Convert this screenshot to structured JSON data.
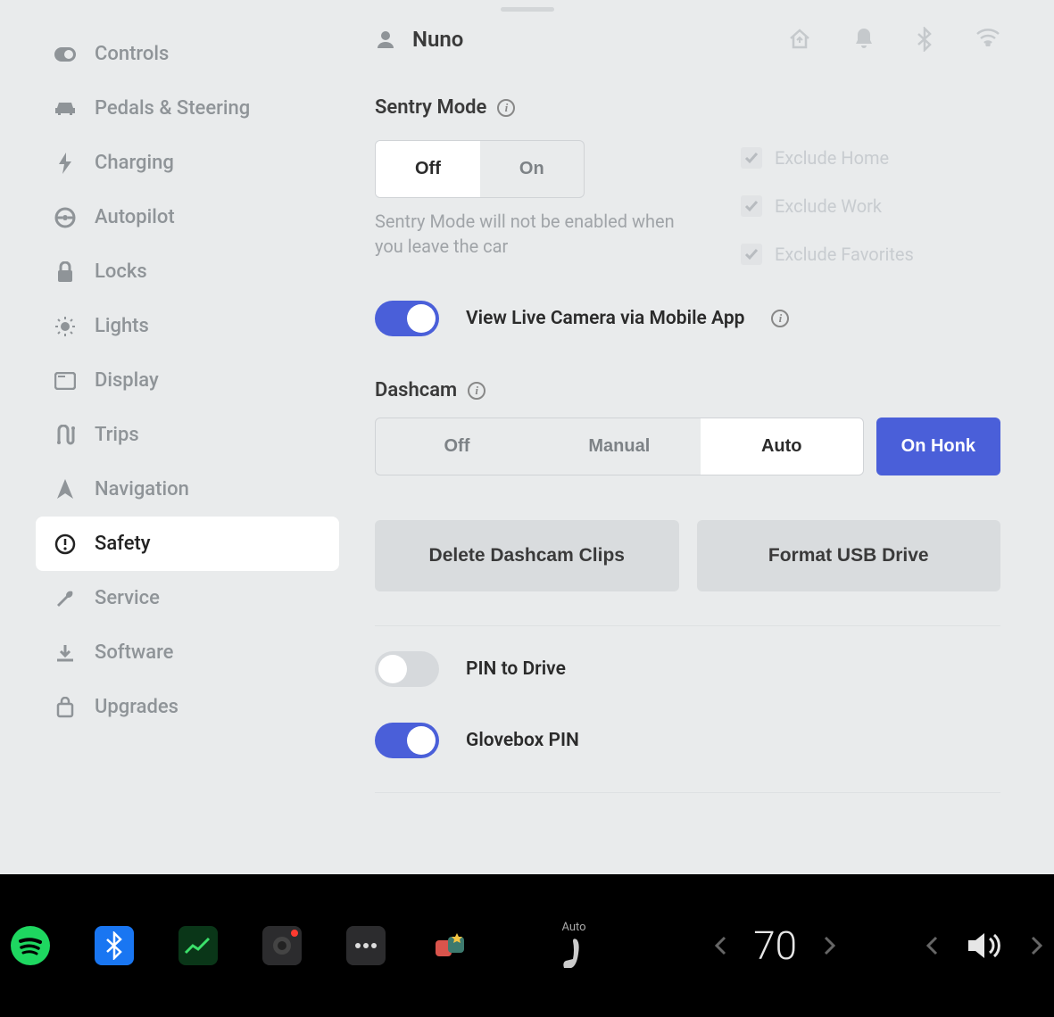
{
  "sidebar": {
    "items": [
      {
        "label": "Controls"
      },
      {
        "label": "Pedals & Steering"
      },
      {
        "label": "Charging"
      },
      {
        "label": "Autopilot"
      },
      {
        "label": "Locks"
      },
      {
        "label": "Lights"
      },
      {
        "label": "Display"
      },
      {
        "label": "Trips"
      },
      {
        "label": "Navigation"
      },
      {
        "label": "Safety"
      },
      {
        "label": "Service"
      },
      {
        "label": "Software"
      },
      {
        "label": "Upgrades"
      }
    ]
  },
  "header": {
    "profile_name": "Nuno"
  },
  "sentry": {
    "title": "Sentry Mode",
    "off": "Off",
    "on": "On",
    "help_text": "Sentry Mode will not be enabled when you leave the car",
    "exclude_home": "Exclude Home",
    "exclude_work": "Exclude Work",
    "exclude_favorites": "Exclude Favorites"
  },
  "live_camera": {
    "label": "View Live Camera via Mobile App"
  },
  "dashcam": {
    "title": "Dashcam",
    "off": "Off",
    "manual": "Manual",
    "auto": "Auto",
    "on_honk": "On Honk"
  },
  "actions": {
    "delete": "Delete Dashcam Clips",
    "format": "Format USB Drive"
  },
  "pin_drive": {
    "label": "PIN to Drive"
  },
  "glovebox": {
    "label": "Glovebox PIN"
  },
  "bottombar": {
    "seat_mode": "Auto",
    "temperature": "70"
  }
}
